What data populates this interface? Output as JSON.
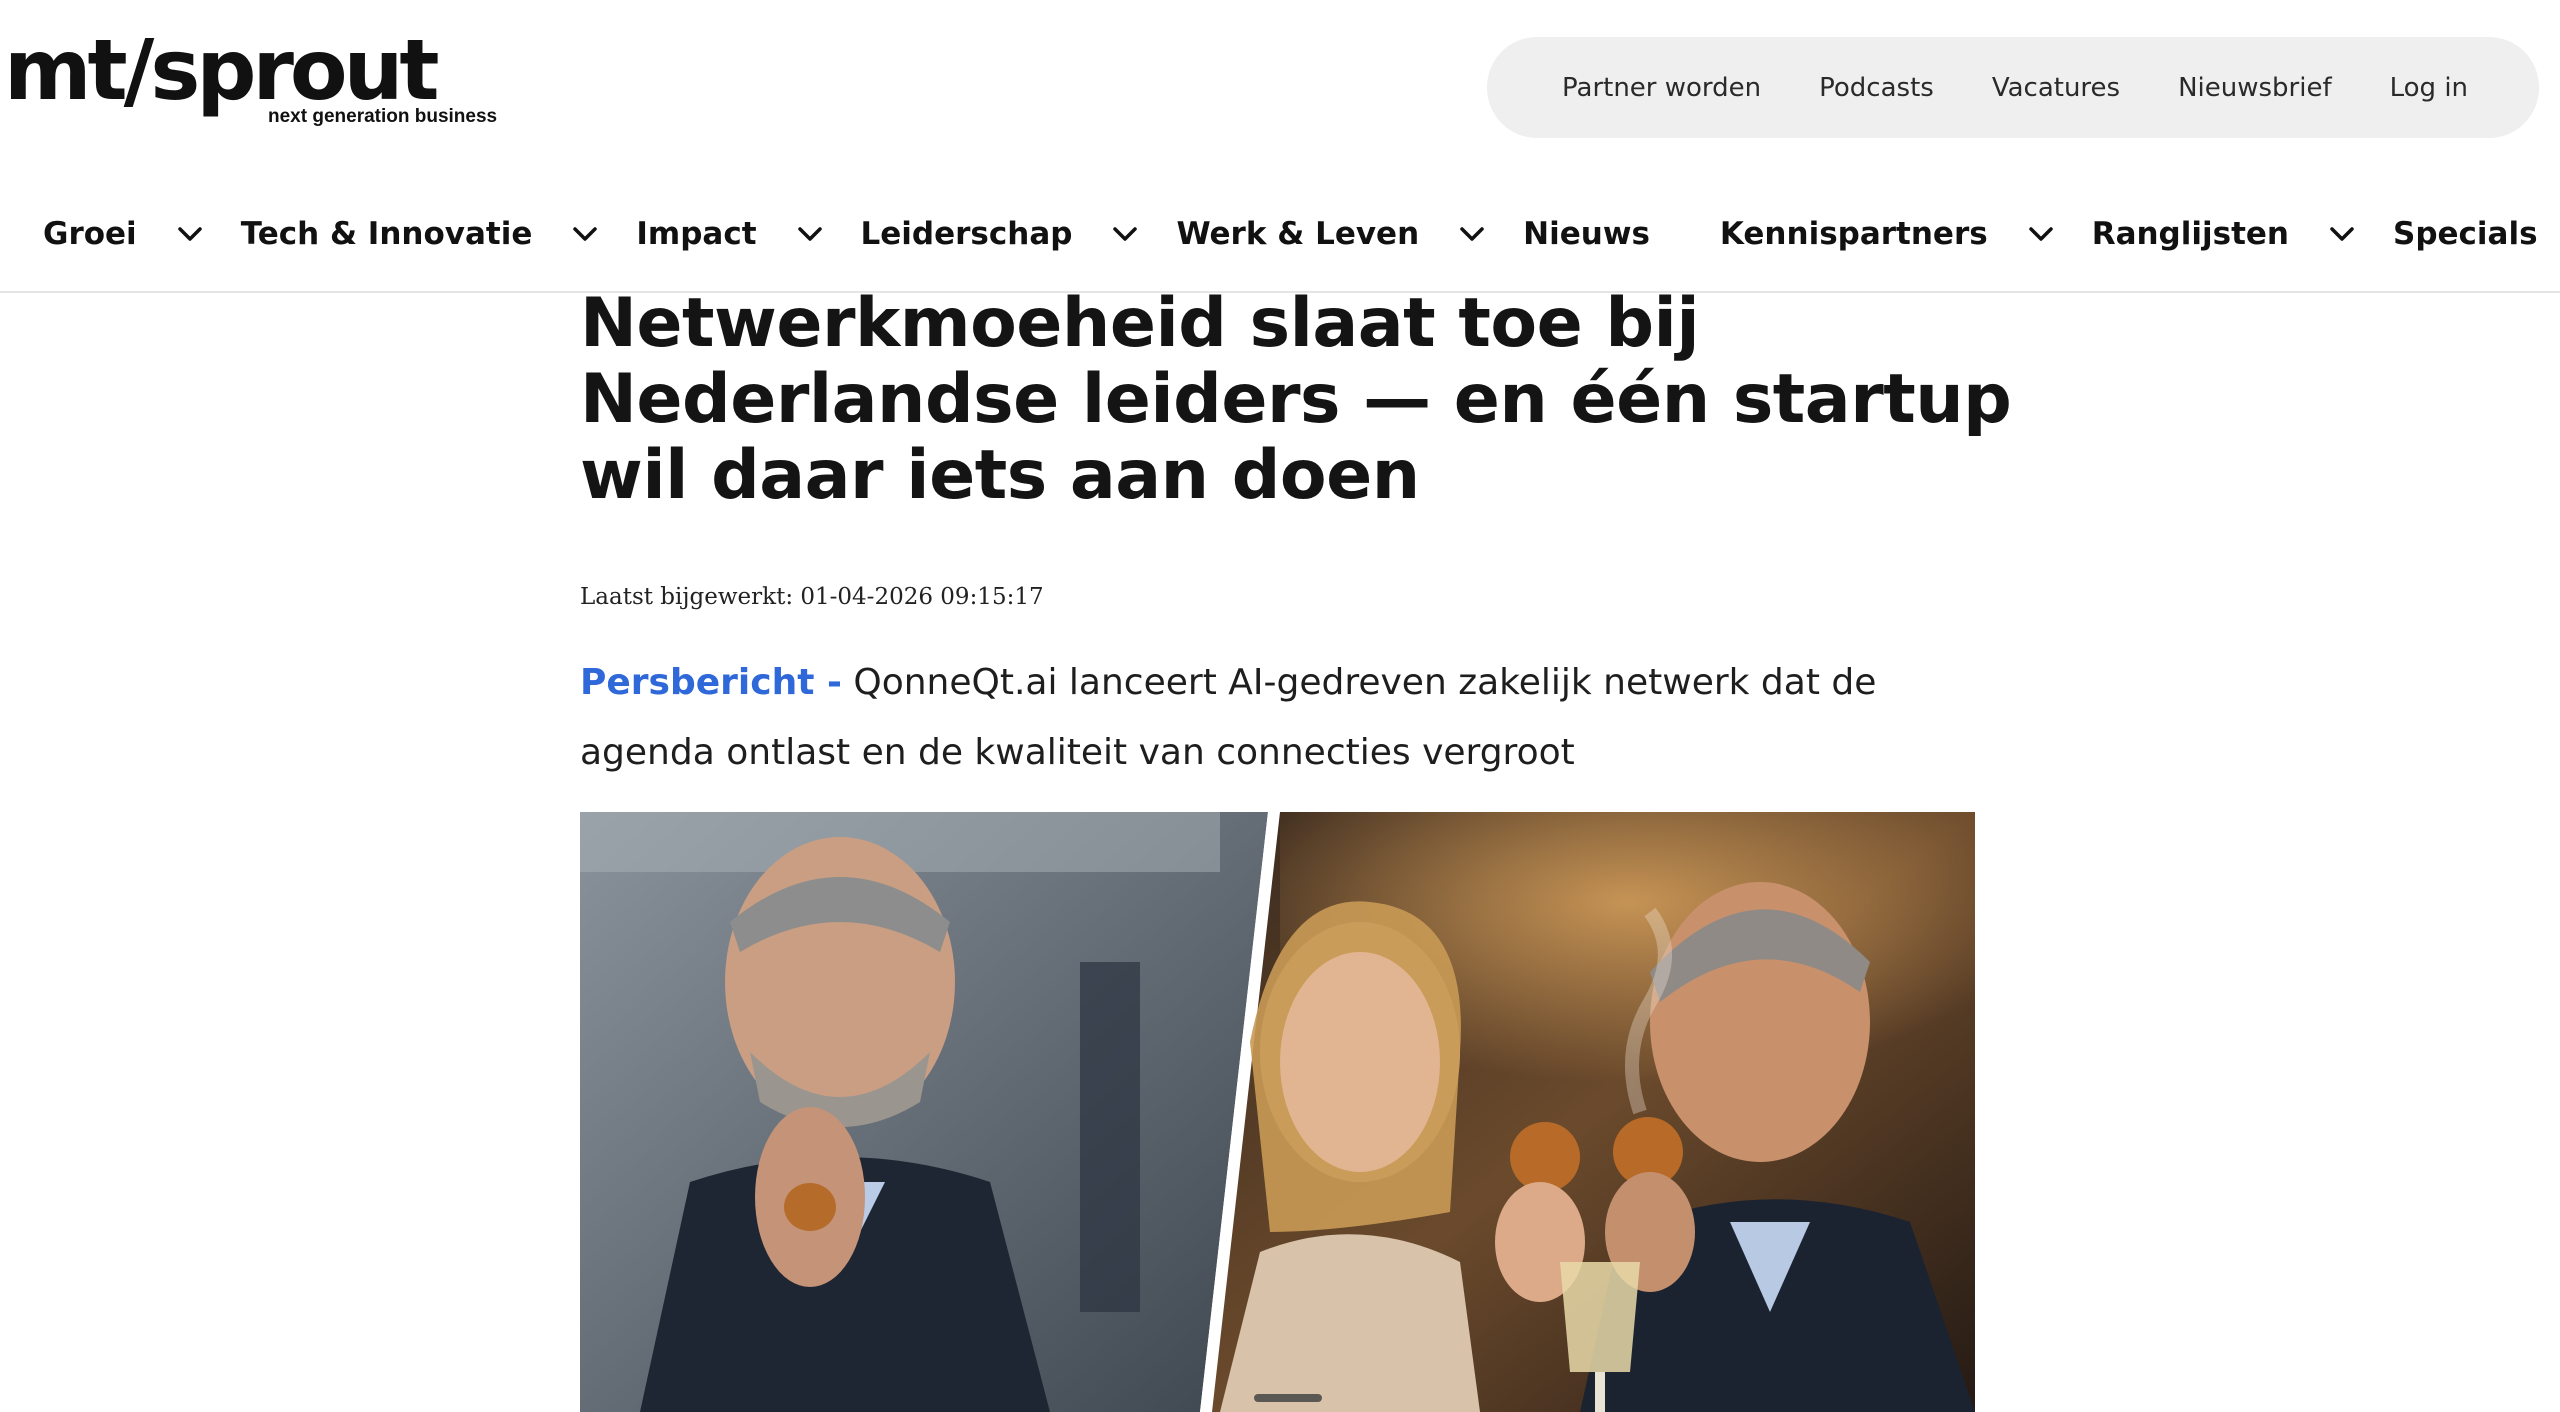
{
  "logo": {
    "main": "mt/sprout",
    "tagline": "next generation business"
  },
  "topnav": [
    "Partner worden",
    "Podcasts",
    "Vacatures",
    "Nieuwsbrief",
    "Log in"
  ],
  "mainnav": [
    {
      "label": "Groei",
      "has_dropdown": true
    },
    {
      "label": "Tech & Innovatie",
      "has_dropdown": true
    },
    {
      "label": "Impact",
      "has_dropdown": true
    },
    {
      "label": "Leiderschap",
      "has_dropdown": true
    },
    {
      "label": "Werk & Leven",
      "has_dropdown": true
    },
    {
      "label": "Nieuws",
      "has_dropdown": false
    },
    {
      "label": "Kennispartners",
      "has_dropdown": true
    },
    {
      "label": "Ranglijsten",
      "has_dropdown": true
    },
    {
      "label": "Specials",
      "has_dropdown": true
    }
  ],
  "article": {
    "title": "Netwerkmoeheid slaat toe bij Nederlandse leiders — en één startup wil daar iets aan doen",
    "updated": "Laatst bijgewerkt: 01-04-2026 09:15:17",
    "kicker": "Persbericht -",
    "lead": "QonneQt.ai lanceert AI-gedreven zakelijk netwerk dat de agenda ontlast en de kwaliteit van connecties vergroot"
  },
  "colors": {
    "accent": "#2f68d8",
    "pill_bg": "#efefef",
    "text": "#141414"
  },
  "icons": {
    "nav_dropdown": "chevron-down-icon"
  }
}
